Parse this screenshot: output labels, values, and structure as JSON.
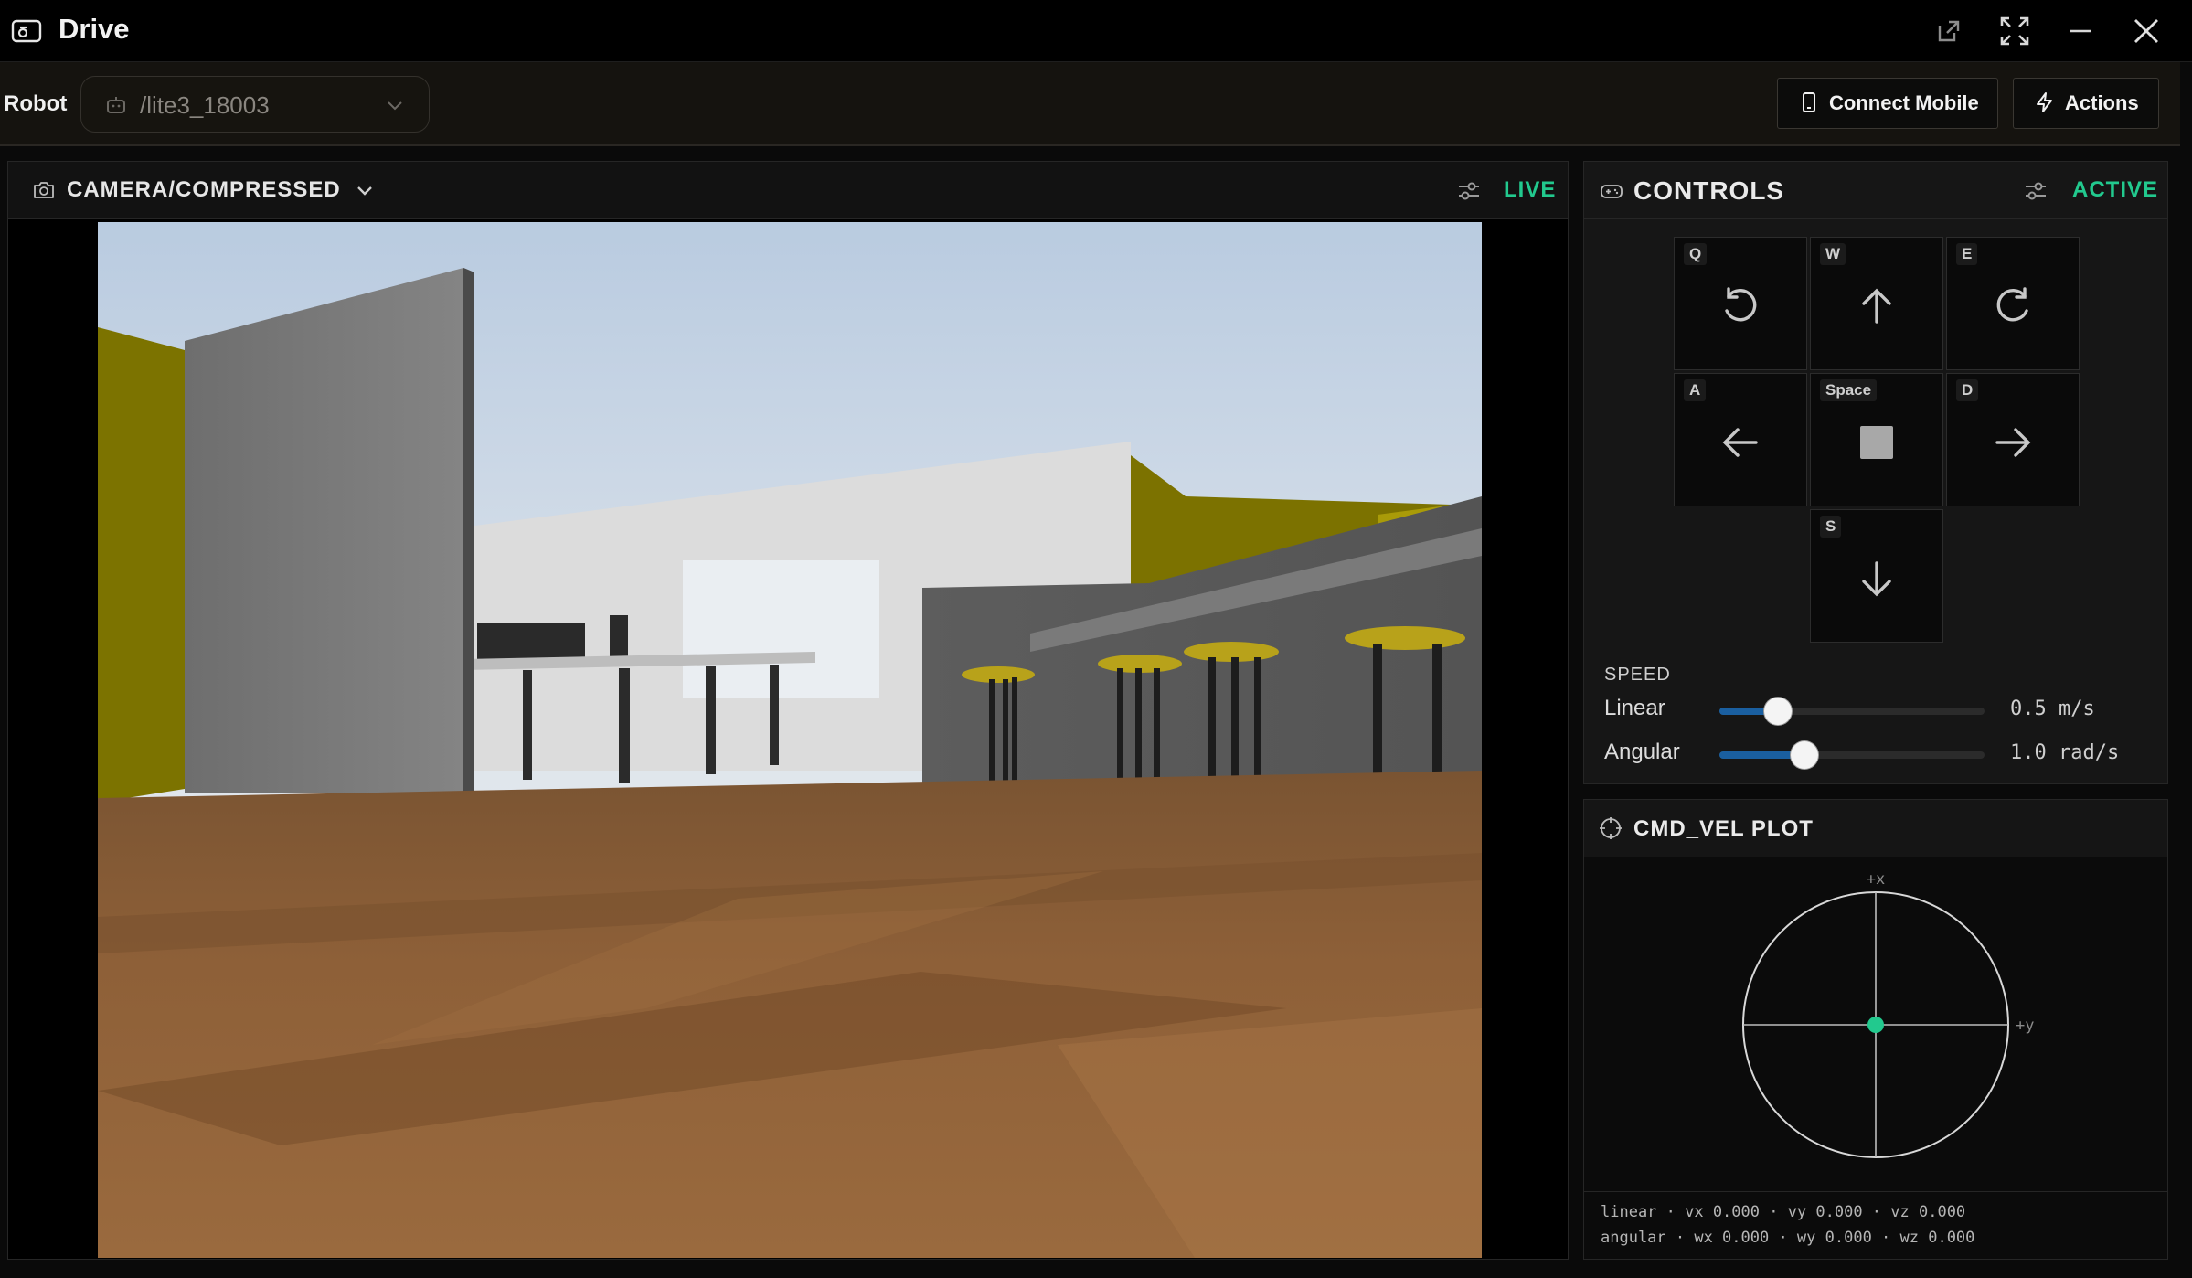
{
  "window": {
    "title": "Drive",
    "icons": [
      "drive-icon",
      "open-external-icon",
      "maximize-icon",
      "minimize-icon",
      "close-icon"
    ]
  },
  "robot_bar": {
    "label": "Robot",
    "selected_robot": "/lite3_18003",
    "connect_mobile_label": "Connect Mobile",
    "actions_label": "Actions"
  },
  "camera": {
    "topic": "CAMERA/COMPRESSED",
    "status": "LIVE"
  },
  "controls": {
    "title": "CONTROLS",
    "status": "ACTIVE",
    "keys": {
      "q": "Q",
      "w": "W",
      "e": "E",
      "a": "A",
      "space": "Space",
      "d": "D",
      "s": "S"
    },
    "speed_title": "SPEED",
    "linear": {
      "label": "Linear",
      "value_text": "0.5 m/s",
      "level": 0.22
    },
    "angular": {
      "label": "Angular",
      "value_text": "1.0 rad/s",
      "level": 0.32
    }
  },
  "plot": {
    "title": "CMD_VEL PLOT",
    "axis_x_label": "+x",
    "axis_y_label": "+y",
    "linear_line": "linear · vx 0.000 · vy 0.000 · vz 0.000",
    "angular_line": "angular · wx 0.000 · wy 0.000 · wz 0.000"
  },
  "colors": {
    "accent_green": "#22c98e",
    "slider_blue": "#1a5fa0"
  }
}
